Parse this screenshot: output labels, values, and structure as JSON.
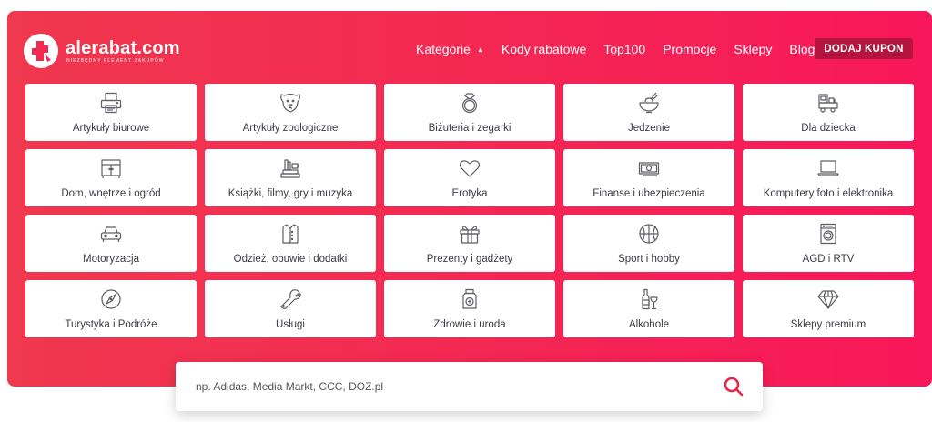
{
  "brand": {
    "name": "alerabat.com",
    "tagline": "NIEZBĘDNY ELEMENT ZAKUPÓW",
    "colors": {
      "primary": "#f32a52",
      "button": "#b4143e",
      "icon_stroke": "#5d5d66",
      "text": "#3b3b44"
    }
  },
  "nav": {
    "items": [
      {
        "label": "Kategorie",
        "has_caret": true
      },
      {
        "label": "Kody rabatowe"
      },
      {
        "label": "Top100"
      },
      {
        "label": "Promocje"
      },
      {
        "label": "Sklepy"
      },
      {
        "label": "Blog"
      }
    ],
    "caret": "▲",
    "add_button": "DODAJ KUPON"
  },
  "categories": [
    {
      "label": "Artykuły biurowe",
      "icon": "printer-icon"
    },
    {
      "label": "Artykuły zoologiczne",
      "icon": "dog-icon"
    },
    {
      "label": "Biżuteria i zegarki",
      "icon": "ring-icon"
    },
    {
      "label": "Jedzenie",
      "icon": "bowl-icon"
    },
    {
      "label": "Dla dziecka",
      "icon": "toy-train-icon"
    },
    {
      "label": "Dom, wnętrze i ogród",
      "icon": "cabinet-icon"
    },
    {
      "label": "Książki, filmy, gry i muzyka",
      "icon": "books-icon"
    },
    {
      "label": "Erotyka",
      "icon": "heart-icon"
    },
    {
      "label": "Finanse i ubezpieczenia",
      "icon": "banknote-icon"
    },
    {
      "label": "Komputery foto i elektronika",
      "icon": "laptop-icon"
    },
    {
      "label": "Motoryzacja",
      "icon": "car-icon"
    },
    {
      "label": "Odzież, obuwie i dodatki",
      "icon": "shirt-icon"
    },
    {
      "label": "Prezenty i gadżety",
      "icon": "gift-icon"
    },
    {
      "label": "Sport i hobby",
      "icon": "basketball-icon"
    },
    {
      "label": "AGD i RTV",
      "icon": "washing-machine-icon"
    },
    {
      "label": "Turystyka i Podróże",
      "icon": "compass-icon"
    },
    {
      "label": "Usługi",
      "icon": "wrench-icon"
    },
    {
      "label": "Zdrowie i uroda",
      "icon": "medicine-jar-icon"
    },
    {
      "label": "Alkohole",
      "icon": "bottle-glass-icon"
    },
    {
      "label": "Sklepy premium",
      "icon": "diamond-icon"
    }
  ],
  "search": {
    "placeholder": "np. Adidas, Media Markt, CCC, DOZ.pl",
    "value": "",
    "icon": "search-icon"
  }
}
